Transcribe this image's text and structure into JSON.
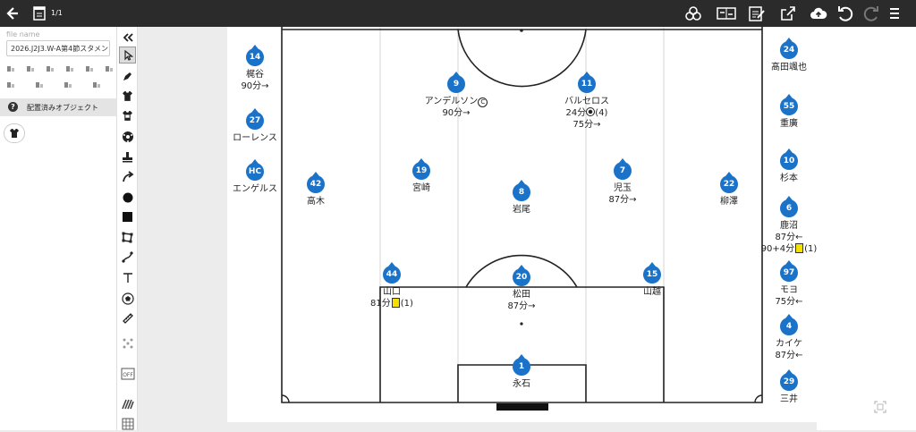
{
  "toolbar": {
    "page_counter": "1/1",
    "icons": [
      "back-arrow-icon",
      "board-list-icon",
      "layers-icon",
      "switch-sides-icon",
      "edit-notes-icon",
      "share-icon",
      "cloud-upload-icon",
      "undo-icon",
      "redo-icon",
      "menu-icon"
    ]
  },
  "left_panel": {
    "file_label": "file name",
    "file_name": "2026.J2J3.W-A第4節スタメン",
    "objects_header": "配置済みオブジェクト",
    "placed_object_icon": "shirt-icon"
  },
  "tools": [
    "collapse-icon",
    "select-icon",
    "pen-icon",
    "shirt-icon",
    "shirt-dark-icon",
    "ball-icon",
    "stamp-icon",
    "arrow-icon",
    "circle-icon",
    "square-icon",
    "polygon-icon",
    "curve-icon",
    "text-icon",
    "ball-outline-icon",
    "ruler-icon",
    "formation-icon",
    "off-toggle-icon",
    "pattern-icon",
    "grid-icon"
  ],
  "colors": {
    "badge": "#1a73c8",
    "yellow_card": "#f5e000",
    "topbar": "#2b2b2b"
  },
  "starters": [
    {
      "num": "9",
      "name": "アンデルソン",
      "captain": true,
      "lines": [
        "90分→"
      ]
    },
    {
      "num": "11",
      "name": "バルセロス",
      "lines": [
        "24分⚽(4)",
        "75分→"
      ]
    },
    {
      "num": "19",
      "name": "宮崎",
      "lines": []
    },
    {
      "num": "8",
      "name": "岩尾",
      "lines": []
    },
    {
      "num": "7",
      "name": "児玉",
      "lines": [
        "87分→"
      ]
    },
    {
      "num": "42",
      "name": "高木",
      "lines": []
    },
    {
      "num": "22",
      "name": "柳澤",
      "lines": []
    },
    {
      "num": "44",
      "name": "山口",
      "lines": [
        "81分 (1)"
      ]
    },
    {
      "num": "20",
      "name": "松田",
      "lines": [
        "87分→"
      ]
    },
    {
      "num": "15",
      "name": "山越",
      "lines": []
    },
    {
      "num": "1",
      "name": "永石",
      "lines": []
    }
  ],
  "left_bench": [
    {
      "num": "14",
      "name": "梶谷",
      "lines": [
        "90分→"
      ]
    },
    {
      "num": "27",
      "name": "ローレンス",
      "lines": []
    },
    {
      "num": "HC",
      "name": "エンゲルス",
      "lines": []
    }
  ],
  "right_bench": [
    {
      "num": "24",
      "name": "髙田颯也",
      "lines": []
    },
    {
      "num": "55",
      "name": "重廣",
      "lines": []
    },
    {
      "num": "10",
      "name": "杉本",
      "lines": []
    },
    {
      "num": "6",
      "name": "鹿沼",
      "lines": [
        "87分←",
        "90+4分 (1)"
      ]
    },
    {
      "num": "97",
      "name": "モヨ",
      "lines": [
        "75分←"
      ]
    },
    {
      "num": "4",
      "name": "カイケ",
      "lines": [
        "87分←"
      ]
    },
    {
      "num": "29",
      "name": "三井",
      "lines": []
    }
  ]
}
